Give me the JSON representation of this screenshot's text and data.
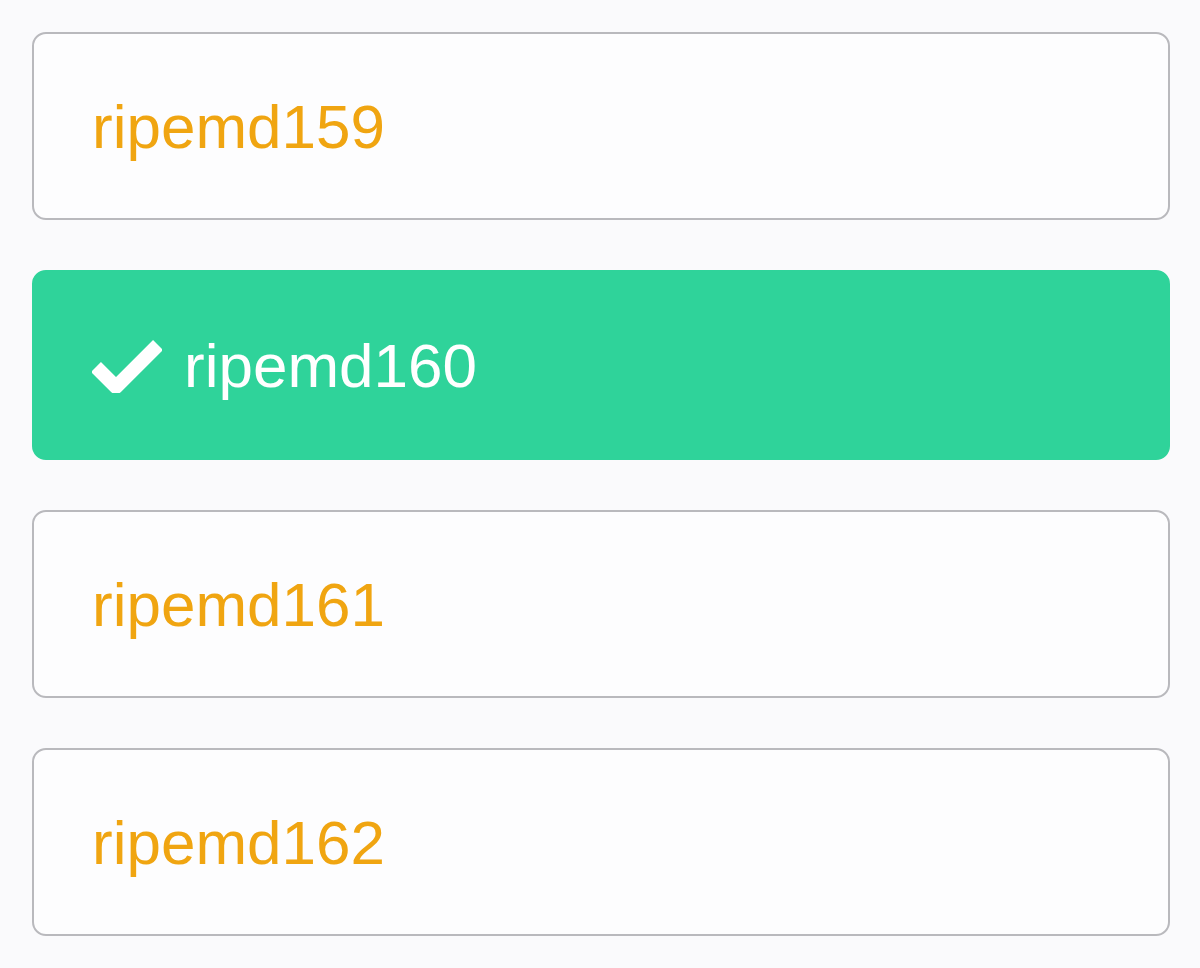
{
  "options": [
    {
      "label": "ripemd159",
      "selected": false
    },
    {
      "label": "ripemd160",
      "selected": true
    },
    {
      "label": "ripemd161",
      "selected": false
    },
    {
      "label": "ripemd162",
      "selected": false
    }
  ]
}
